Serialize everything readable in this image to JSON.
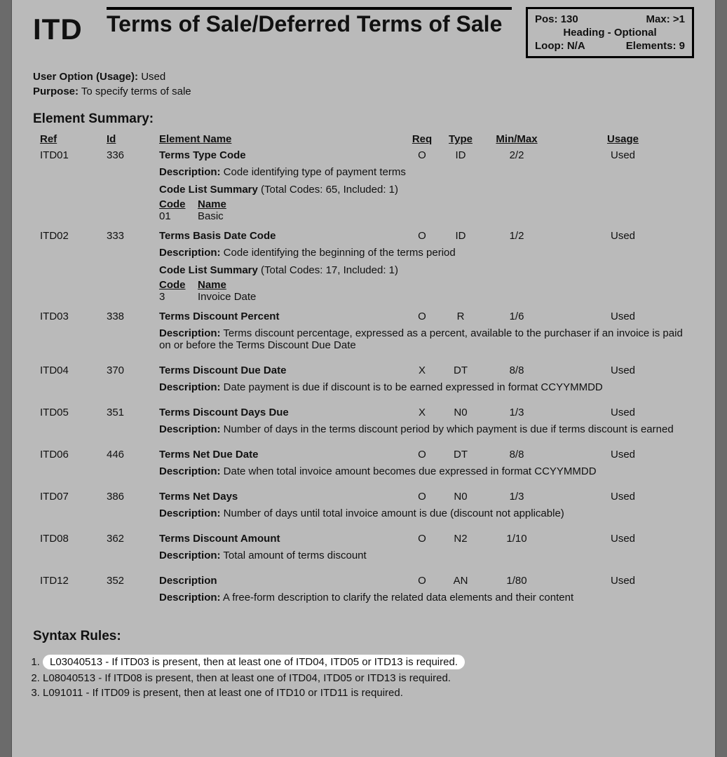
{
  "segment": {
    "code": "ITD",
    "title": "Terms of Sale/Deferred Terms of Sale",
    "pos_label": "Pos:",
    "pos_value": "130",
    "max_label": "Max:",
    "max_value": ">1",
    "area": "Heading - Optional",
    "loop_label": "Loop:",
    "loop_value": "N/A",
    "elements_label": "Elements:",
    "elements_value": "9"
  },
  "meta": {
    "user_option_label": "User Option (Usage):",
    "user_option_value": "Used",
    "purpose_label": "Purpose:",
    "purpose_value": "To specify terms of sale"
  },
  "section_summary": "Element Summary:",
  "columns": {
    "ref": "Ref",
    "id": "Id",
    "name": "Element Name",
    "req": "Req",
    "type": "Type",
    "minmax": "Min/Max",
    "usage": "Usage"
  },
  "labels": {
    "description": "Description:",
    "code_list_summary": "Code List Summary",
    "code": "Code",
    "name": "Name"
  },
  "elements": [
    {
      "ref": "ITD01",
      "id": "336",
      "name": "Terms Type Code",
      "req": "O",
      "type": "ID",
      "minmax": "2/2",
      "usage": "Used",
      "description": "Code identifying type of payment terms",
      "code_list_note": "(Total Codes: 65, Included: 1)",
      "codes": [
        {
          "code": "01",
          "name": "Basic"
        }
      ]
    },
    {
      "ref": "ITD02",
      "id": "333",
      "name": "Terms Basis Date Code",
      "req": "O",
      "type": "ID",
      "minmax": "1/2",
      "usage": "Used",
      "description": "Code identifying the beginning of the terms period",
      "code_list_note": "(Total Codes: 17, Included: 1)",
      "codes": [
        {
          "code": "3",
          "name": "Invoice Date"
        }
      ]
    },
    {
      "ref": "ITD03",
      "id": "338",
      "name": "Terms Discount Percent",
      "req": "O",
      "type": "R",
      "minmax": "1/6",
      "usage": "Used",
      "description": "Terms discount percentage, expressed as a percent, available to the purchaser if an invoice is paid on or before the Terms Discount Due Date"
    },
    {
      "ref": "ITD04",
      "id": "370",
      "name": "Terms Discount Due Date",
      "req": "X",
      "type": "DT",
      "minmax": "8/8",
      "usage": "Used",
      "description": "Date payment is due if discount is to be earned expressed in format CCYYMMDD"
    },
    {
      "ref": "ITD05",
      "id": "351",
      "name": "Terms Discount Days Due",
      "req": "X",
      "type": "N0",
      "minmax": "1/3",
      "usage": "Used",
      "description": "Number of days in the terms discount period by which payment is due if terms discount is earned"
    },
    {
      "ref": "ITD06",
      "id": "446",
      "name": "Terms Net Due Date",
      "req": "O",
      "type": "DT",
      "minmax": "8/8",
      "usage": "Used",
      "description": "Date when total invoice amount becomes due expressed in format CCYYMMDD"
    },
    {
      "ref": "ITD07",
      "id": "386",
      "name": "Terms Net Days",
      "req": "O",
      "type": "N0",
      "minmax": "1/3",
      "usage": "Used",
      "description": "Number of days until total invoice amount is due (discount not applicable)"
    },
    {
      "ref": "ITD08",
      "id": "362",
      "name": "Terms Discount Amount",
      "req": "O",
      "type": "N2",
      "minmax": "1/10",
      "usage": "Used",
      "description": "Total amount of terms discount"
    },
    {
      "ref": "ITD12",
      "id": "352",
      "name": "Description",
      "req": "O",
      "type": "AN",
      "minmax": "1/80",
      "usage": "Used",
      "description": "A free-form description to clarify the related data elements and their content"
    }
  ],
  "syntax_heading": "Syntax Rules:",
  "syntax_rules": [
    {
      "text": "L03040513 - If ITD03 is present, then at least one of ITD04, ITD05 or ITD13 is required.",
      "highlight": true
    },
    {
      "text": "L08040513 - If ITD08 is present, then at least one of ITD04, ITD05 or ITD13 is required.",
      "highlight": false
    },
    {
      "text": "L091011 - If ITD09 is present, then at least one of ITD10 or ITD11 is required.",
      "highlight": false
    }
  ]
}
